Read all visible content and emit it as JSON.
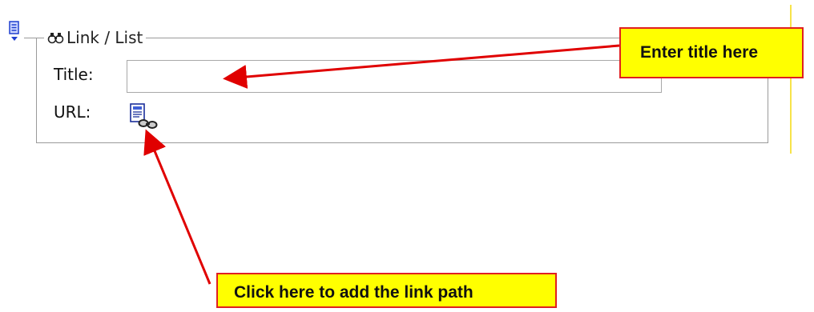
{
  "groupbox": {
    "title": "Link / List",
    "legend_icon": "binoculars-icon"
  },
  "form": {
    "title_label": "Title:",
    "title_value": "",
    "title_placeholder": "",
    "url_label": "URL:",
    "url_button_icon": "link-document-icon"
  },
  "page_menu_icon": "page-menu-icon",
  "annotations": {
    "title_callout": "Enter title here",
    "url_callout": "Click here to add the link path",
    "callout_fill": "#ffff00",
    "callout_border": "#e02020",
    "arrow_color": "#e00000"
  }
}
